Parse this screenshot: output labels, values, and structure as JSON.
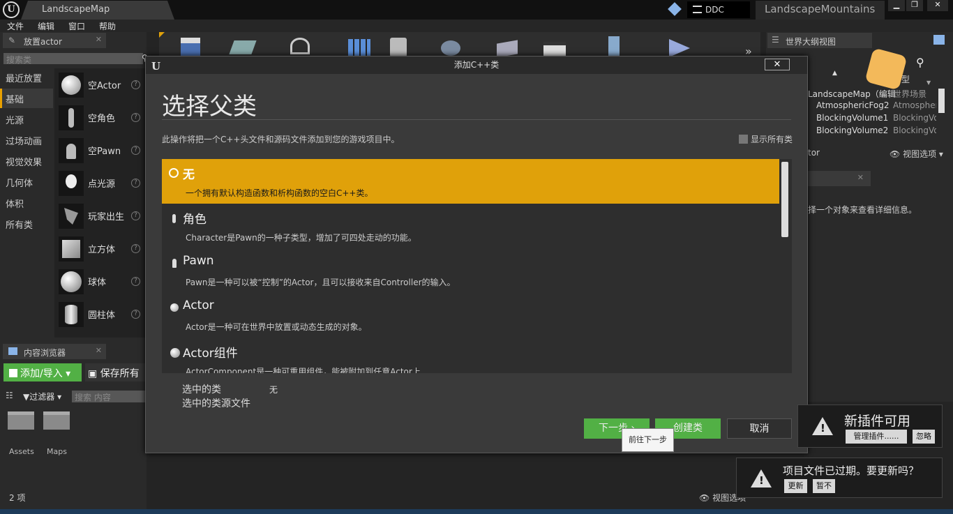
{
  "app": {
    "tab_title": "LandscapeMap",
    "ddc_label": "DDC",
    "project_name": "LandscapeMountains",
    "menu": [
      "文件",
      "编辑",
      "窗口",
      "帮助"
    ]
  },
  "place_actor": {
    "tab_label": "放置actor",
    "search_placeholder": "搜索类",
    "categories": [
      "最近放置",
      "基础",
      "光源",
      "过场动画",
      "视觉效果",
      "几何体",
      "体积",
      "所有类"
    ],
    "selected_category": "基础",
    "items": [
      "空Actor",
      "空角色",
      "空Pawn",
      "点光源",
      "玩家出生",
      "立方体",
      "球体",
      "圆柱体"
    ]
  },
  "content_browser": {
    "tab_label": "内容浏览器",
    "add_import_label": "添加/导入",
    "save_all_label": "保存所有",
    "filter_label": "过滤器",
    "search_placeholder": "搜索 内容",
    "folders": [
      "Assets",
      "Maps"
    ],
    "item_count": "2 项",
    "view_options_label": "视图选项"
  },
  "outliner": {
    "tab_label": "世界大纲视图",
    "type_header": "型",
    "rows": [
      {
        "name": "LandscapeMap（编辑",
        "type": "世界场景"
      },
      {
        "name": "AtmosphericFog2",
        "type": "Atmospheric"
      },
      {
        "name": "BlockingVolume1",
        "type": "BlockingVol"
      },
      {
        "name": "BlockingVolume2",
        "type": "BlockingVol"
      }
    ],
    "actor_count_partial": "tor",
    "view_options_label": "视图选项",
    "details_hint": "择一个对象来查看详细信息。"
  },
  "dialog": {
    "window_title": "添加C++类",
    "close_glyph": "✕",
    "heading": "选择父类",
    "description": "此操作将把一个C++头文件和源码文件添加到您的游戏项目中。",
    "show_all_label": "显示所有类",
    "options": [
      {
        "title": "无",
        "desc": "一个拥有默认构造函数和析构函数的空白C++类。"
      },
      {
        "title": "角色",
        "desc": "Character是Pawn的一种子类型，增加了可四处走动的功能。"
      },
      {
        "title": "Pawn",
        "desc": "Pawn是一种可以被“控制”的Actor，且可以接收来自Controller的输入。"
      },
      {
        "title": "Actor",
        "desc": "Actor是一种可在世界中放置或动态生成的对象。"
      },
      {
        "title": "Actor组件",
        "desc": "ActorComponent是一种可重用组件，能被附加到任意Actor上"
      }
    ],
    "selected_class_label": "选中的类",
    "selected_class_value": "无",
    "selected_source_label": "选中的类源文件",
    "next_label": "下一步",
    "create_label": "创建类",
    "cancel_label": "取消",
    "tooltip": "前往下一步"
  },
  "notifications": {
    "plugin": {
      "title": "新插件可用",
      "manage_label": "管理插件......",
      "ignore_label": "忽略"
    },
    "project": {
      "title": "项目文件已过期。要更新吗？",
      "update_label": "更新",
      "later_label": "暂不"
    }
  },
  "colors": {
    "accent": "#e0a10a",
    "green_button": "#52b045"
  }
}
